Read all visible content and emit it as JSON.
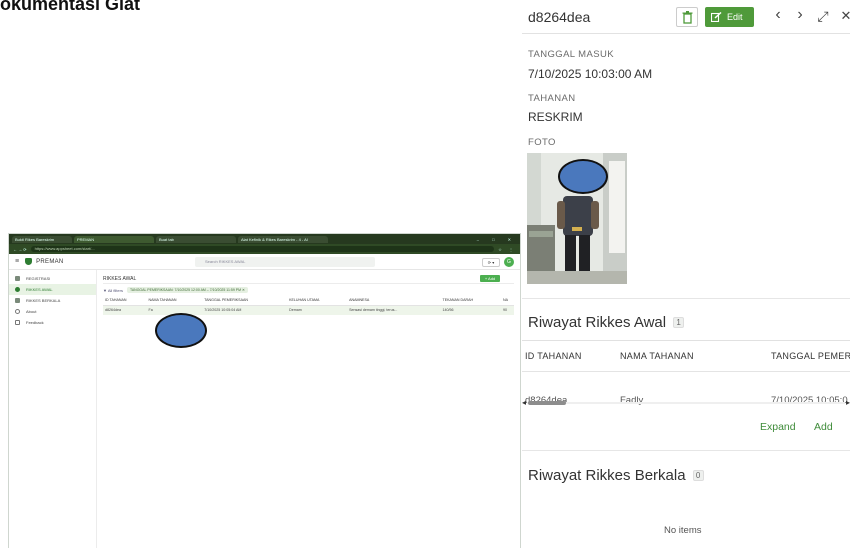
{
  "doc": {
    "title": "okumentasi Giat"
  },
  "screenshot": {
    "tabs": [
      "Bukti Rikes Bareskrim",
      "PREMAN",
      "Buat tab",
      "Alat Kefinik & Rikes Bareskrim - 4 - AI"
    ],
    "url": "https://www.appsheet.com/start/...",
    "app_name": "PREMAN",
    "search_placeholder": "Search RIKKES AWAL",
    "chip": "⟳ ▾",
    "avatar": "G",
    "side": [
      "REGISTRASI",
      "RIKKES AWAL",
      "RIKKES BERKALA",
      "About",
      "Feedback"
    ],
    "main_title": "RIKKES AWAL",
    "add_label": "+ Add",
    "filter_all": "▼ All filters",
    "filter_chip": "TANGGAL PEMERIKSAAN: 7/10/2025 12:00 AM – 7/10/2025 11:59 PM ✕",
    "columns": [
      "ID TAHANAN",
      "NAMA TAHANAN",
      "TANGGAL PEMERIKSAAN",
      "KELUHAN UTAMA",
      "ANAMNESA",
      "TEKANAN DARAH",
      "NA"
    ],
    "row": [
      "d8264dea",
      "Fa",
      "7/10/2025 10:05:04 AM",
      "Demam",
      "Sensasi demam tinggi, terus...",
      "140/56",
      "90"
    ]
  },
  "panel": {
    "record_id": "d8264dea",
    "edit_label": "Edit",
    "nav": {
      "prev": "‹",
      "next": "›",
      "expand": "⤢",
      "close": "✕"
    },
    "fields": {
      "tanggal_masuk_label": "TANGGAL MASUK",
      "tanggal_masuk_value": "7/10/2025 10:03:00 AM",
      "tahanan_label": "TAHANAN",
      "tahanan_value": "RESKRIM",
      "foto_label": "FOTO"
    },
    "rikkes_awal": {
      "title": "Riwayat Rikkes Awal",
      "count": "1",
      "columns": [
        "ID TAHANAN",
        "NAMA TAHANAN",
        "TANGGAL PEMER"
      ],
      "rows": [
        [
          "d8264dea",
          "Fadly",
          "7/10/2025 10:05:0"
        ]
      ],
      "expand_label": "Expand",
      "add_label": "Add"
    },
    "rikkes_berkala": {
      "title": "Riwayat Rikkes Berkala",
      "count": "0",
      "empty_label": "No items"
    }
  },
  "colors": {
    "accent": "#4f9a3a",
    "redaction": "#4a78bd"
  },
  "icons": {
    "trash": "trash-icon",
    "edit": "edit-icon"
  }
}
